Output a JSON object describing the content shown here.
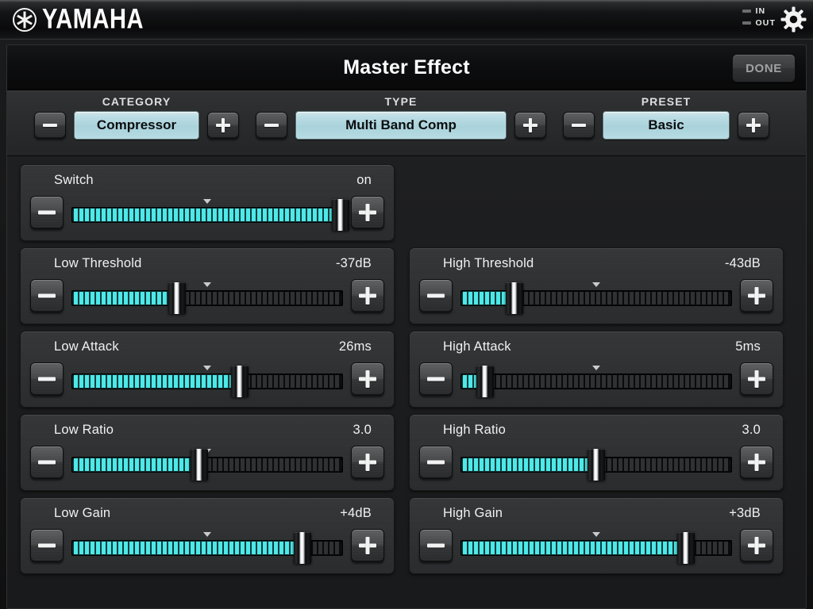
{
  "brand": {
    "name": "YAMAHA",
    "logo_icon": "yamaha-tuning-fork-icon",
    "gear_icon": "gear-icon",
    "io": [
      {
        "label": "IN",
        "led_color": "#6a6c6e"
      },
      {
        "label": "OUT",
        "led_color": "#6a6c6e"
      }
    ]
  },
  "titlebar": {
    "title": "Master Effect",
    "done_label": "DONE"
  },
  "selectors": [
    {
      "caption": "CATEGORY",
      "value": "Compressor",
      "minus_label": "−",
      "plus_label": "+",
      "minus_icon": "minus-icon",
      "plus_icon": "plus-icon"
    },
    {
      "caption": "TYPE",
      "value": "Multi Band Comp",
      "minus_label": "−",
      "plus_label": "+",
      "minus_icon": "minus-icon",
      "plus_icon": "plus-icon"
    },
    {
      "caption": "PRESET",
      "value": "Basic",
      "minus_label": "−",
      "plus_label": "+",
      "minus_icon": "minus-icon",
      "plus_icon": "plus-icon"
    }
  ],
  "colors": {
    "led_cyan": "#4ee8e8",
    "value_display_bg": "#a9d2db",
    "panel_bg": "#2e3032",
    "text": "#f0f1f2",
    "done_text": "#9fa1a3"
  },
  "parameters": [
    {
      "label": "Switch",
      "value": "on",
      "fill_pct": 100,
      "thumb_pct": 100,
      "marker_pct": 50,
      "column": "left"
    },
    {
      "label": null,
      "value": null,
      "fill_pct": 0,
      "thumb_pct": 0,
      "marker_pct": 50,
      "column": "right",
      "empty": true
    },
    {
      "label": "Low Threshold",
      "value": "-37dB",
      "fill_pct": 39,
      "thumb_pct": 39,
      "marker_pct": 50,
      "column": "left"
    },
    {
      "label": "High Threshold",
      "value": "-43dB",
      "fill_pct": 20,
      "thumb_pct": 20,
      "marker_pct": 50,
      "column": "right"
    },
    {
      "label": "Low Attack",
      "value": "26ms",
      "fill_pct": 62,
      "thumb_pct": 62,
      "marker_pct": 50,
      "column": "left"
    },
    {
      "label": "High Attack",
      "value": "5ms",
      "fill_pct": 9,
      "thumb_pct": 9,
      "marker_pct": 50,
      "column": "right"
    },
    {
      "label": "Low Ratio",
      "value": "3.0",
      "fill_pct": 47,
      "thumb_pct": 47,
      "marker_pct": 50,
      "column": "left"
    },
    {
      "label": "High Ratio",
      "value": "3.0",
      "fill_pct": 50,
      "thumb_pct": 50,
      "marker_pct": 50,
      "column": "right"
    },
    {
      "label": "Low Gain",
      "value": "+4dB",
      "fill_pct": 85,
      "thumb_pct": 85,
      "marker_pct": 50,
      "column": "left"
    },
    {
      "label": "High Gain",
      "value": "+3dB",
      "fill_pct": 83,
      "thumb_pct": 83,
      "marker_pct": 50,
      "column": "right"
    }
  ],
  "param_controls": {
    "minus_label": "−",
    "plus_label": "+",
    "minus_icon": "minus-icon",
    "plus_icon": "plus-icon"
  }
}
